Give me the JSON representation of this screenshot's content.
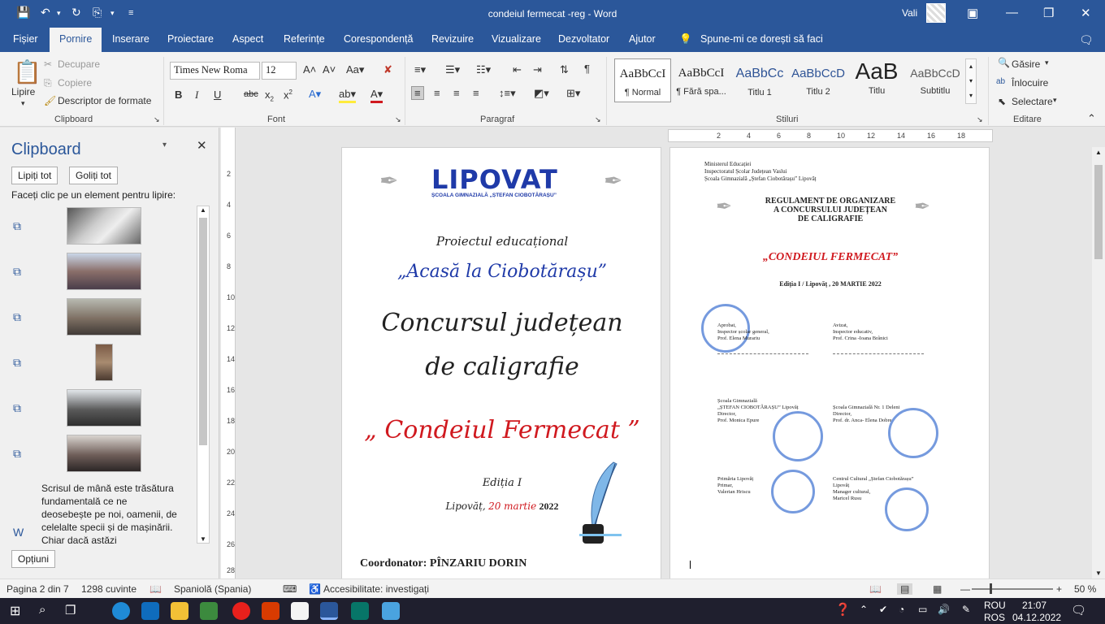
{
  "window": {
    "title": "condeiul fermecat  -reg  -  Word",
    "user": "Vali",
    "controls": [
      "ribbon-display-icon",
      "minimize-icon",
      "restore-icon",
      "close-icon"
    ]
  },
  "menu": {
    "tabs": [
      "Fișier",
      "Pornire",
      "Inserare",
      "Proiectare",
      "Aspect",
      "Referințe",
      "Corespondență",
      "Revizuire",
      "Vizualizare",
      "Dezvoltator",
      "Ajutor"
    ],
    "active": "Pornire",
    "search": "Spune-mi ce dorești să faci"
  },
  "ribbon": {
    "clipboard": {
      "label": "Clipboard",
      "paste": "Lipire",
      "cut": "Decupare",
      "copy": "Copiere",
      "format_painter": "Descriptor de formate"
    },
    "font": {
      "label": "Font",
      "family": "Times New Roma",
      "size": "12"
    },
    "paragraph": {
      "label": "Paragraf"
    },
    "styles": {
      "label": "Stiluri",
      "items": [
        {
          "preview": "AaBbCcI",
          "name": "¶ Normal"
        },
        {
          "preview": "AaBbCcI",
          "name": "¶ Fără spa..."
        },
        {
          "preview": "AaBbCc",
          "name": "Titlu 1"
        },
        {
          "preview": "AaBbCcD",
          "name": "Titlu 2"
        },
        {
          "preview": "AaB",
          "name": "Titlu"
        },
        {
          "preview": "AaBbCcD",
          "name": "Subtitlu"
        }
      ]
    },
    "editing": {
      "label": "Editare",
      "find": "Găsire",
      "replace": "Înlocuire",
      "select": "Selectare"
    }
  },
  "clipboard_pane": {
    "title": "Clipboard",
    "paste_all": "Lipiți tot",
    "clear_all": "Goliți tot",
    "hint": "Faceți clic pe un element pentru lipire:",
    "text_item": "Scrisul de mână este trăsătura fundamentală ce ne deosebește pe noi, oamenii, de celelalte specii și de mașinării. Chiar dacă astăzi",
    "options": "Opțiuni"
  },
  "page1": {
    "logo": "LIPOVAT",
    "logo_sub": "ȘCOALA GIMNAZIALĂ „ȘTEFAN CIOBOTĂRAȘU”",
    "project": "Proiectul educațional",
    "project_name": "„Acasă la Ciobotărașu”",
    "contest_l1": "Concursul județean",
    "contest_l2": "de caligrafie",
    "contest_name": "„ Condeiul Fermecat ”",
    "edition": "Ediția  I",
    "place": "Lipovăț,",
    "date_red": "20 martie",
    "year": "2022",
    "coordinator": "Coordonator: PÎNZARIU  DORIN"
  },
  "page2": {
    "header": [
      "Ministerul Educației",
      "Inspectoratul Școlar Județean Vaslui",
      "Școala Gimnazială „Ștefan Ciobotărașu” Lipovăț"
    ],
    "title": [
      "REGULAMENT  DE  ORGANIZARE",
      "A  CONCURSULUI  JUDEȚEAN",
      "DE CALIGRAFIE"
    ],
    "contest": "„CONDEIUL  FERMECAT”",
    "edition": "Ediția I  / Lipovăț , 20 MARTIE 2022",
    "sig1": [
      "Aprobat,",
      "Inspector școlar general,",
      "Prof. Elena Murariu"
    ],
    "sig2": [
      "Avizat,",
      "Inspector  educativ,",
      "Prof. Crina -Ioana Brânici"
    ],
    "sig3": [
      "Școala  Gimnazială",
      "„ȘTEFAN  CIOBOTĂRAȘU” Lipovăț",
      "Director,",
      "Prof.  Monica Epure"
    ],
    "sig4": [
      "Școala  Gimnazială  Nr. 1 Delеni",
      "Director,",
      "Prof. dr. Anca- Elena  Dobre"
    ],
    "sig5": [
      "Primăria  Lipovăț",
      "Primar,",
      "Valerian  Hriscu"
    ],
    "sig6": [
      "Centrul Cultural „Ștefan  Ciobotărașu”",
      "Lipovăț",
      "Manager cultural,",
      "Maricel  Rusu"
    ]
  },
  "rulers": {
    "vertical": [
      "2",
      "4",
      "6",
      "8",
      "10",
      "12",
      "14",
      "16",
      "18",
      "20",
      "22",
      "24",
      "26",
      "28"
    ],
    "horizontal": [
      "2",
      "4",
      "6",
      "8",
      "10",
      "12",
      "14",
      "16",
      "18"
    ]
  },
  "status": {
    "page": "Pagina 2 din 7",
    "words": "1298 cuvinte",
    "language": "Spaniolă (Spania)",
    "accessibility": "Accesibilitate: investigați",
    "zoom": "50 %"
  },
  "taskbar": {
    "lang1": "ROU",
    "lang2": "ROS",
    "time": "21:07",
    "date": "04.12.2022"
  },
  "colors": {
    "brand": "#2b579a",
    "red_text": "#d0191f",
    "blue_text": "#1f3aa8",
    "stamp": "#3a6fd0"
  }
}
